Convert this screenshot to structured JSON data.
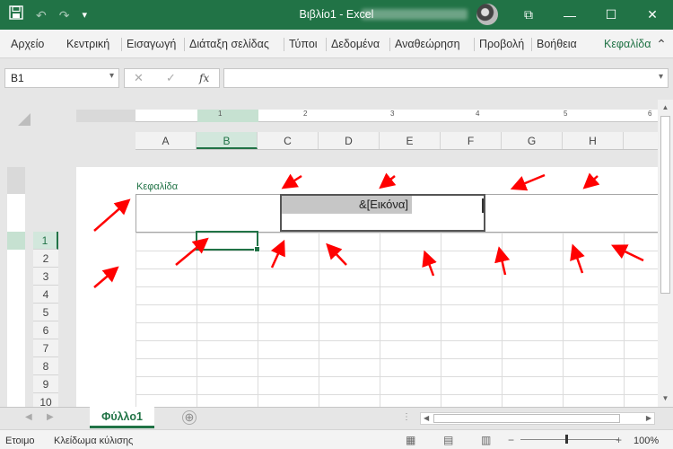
{
  "window": {
    "app_title": "Βιβλίο1  -  Excel",
    "qat_icons": [
      "save-icon",
      "undo-icon",
      "redo-icon",
      "customize-icon"
    ],
    "controls": [
      "ribbon-display-icon",
      "minimize-icon",
      "restore-icon",
      "close-icon"
    ]
  },
  "menu": {
    "tabs": [
      {
        "label": "Αρχείο"
      },
      {
        "label": "Κεντρική"
      },
      {
        "label": "Εισαγωγή"
      },
      {
        "label": "Διάταξη σελίδας"
      },
      {
        "label": "Τύποι"
      },
      {
        "label": "Δεδομένα"
      },
      {
        "label": "Αναθεώρηση"
      },
      {
        "label": "Προβολή"
      },
      {
        "label": "Βοήθεια"
      },
      {
        "label": "Κεφαλίδα"
      }
    ],
    "more_icon": "chevron-up-icon"
  },
  "formula_bar": {
    "name_box": "B1",
    "cancel_symbol": "✕",
    "enter_symbol": "✓",
    "fx_label": "fx",
    "formula_value": ""
  },
  "ruler": {
    "numbers": [
      "1",
      "2",
      "3",
      "4",
      "5",
      "6"
    ]
  },
  "columns": [
    "A",
    "B",
    "C",
    "D",
    "E",
    "F",
    "G",
    "H"
  ],
  "selected_column": "B",
  "rows": [
    "1",
    "2",
    "3",
    "4",
    "5",
    "6",
    "7",
    "8",
    "9",
    "10"
  ],
  "selected_row": "1",
  "page": {
    "header_label": "Κεφαλίδα",
    "header_center_text": "&[Εικόνα]"
  },
  "sheets": {
    "active_tab": "Φύλλο1",
    "add_symbol": "⊕"
  },
  "status": {
    "mode": "Ετοιμο",
    "scroll_lock": "Κλείδωμα κύλισης",
    "zoom": "100%",
    "zoom_minus": "−",
    "zoom_plus": "+"
  },
  "colors": {
    "accent": "#217346",
    "annotation_arrows": "#ff0000"
  }
}
